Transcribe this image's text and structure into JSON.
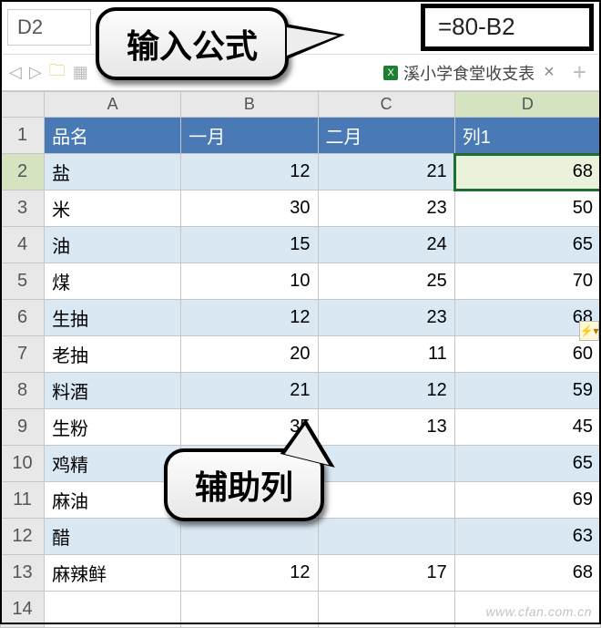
{
  "namebox": "D2",
  "formula": "=80-B2",
  "callouts": {
    "formula_label": "输入公式",
    "helper_col_label": "辅助列"
  },
  "sheet_tab": {
    "title": "溪小学食堂收支表",
    "close": "×",
    "plus": "+"
  },
  "columns": [
    "",
    "A",
    "B",
    "C",
    "D"
  ],
  "header_row": [
    "品名",
    "一月",
    "二月",
    "列1"
  ],
  "active_cell": "D2",
  "selected_column": "D",
  "chart_data": {
    "type": "table",
    "columns": [
      "品名",
      "一月",
      "二月",
      "列1"
    ],
    "rows": [
      {
        "品名": "盐",
        "一月": 12,
        "二月": 21,
        "列1": 68
      },
      {
        "品名": "米",
        "一月": 30,
        "二月": 23,
        "列1": 50
      },
      {
        "品名": "油",
        "一月": 15,
        "二月": 24,
        "列1": 65
      },
      {
        "品名": "煤",
        "一月": 10,
        "二月": 25,
        "列1": 70
      },
      {
        "品名": "生抽",
        "一月": 12,
        "二月": 23,
        "列1": 68
      },
      {
        "品名": "老抽",
        "一月": 20,
        "二月": 11,
        "列1": 60
      },
      {
        "品名": "料酒",
        "一月": 21,
        "二月": 12,
        "列1": 59
      },
      {
        "品名": "生粉",
        "一月": 35,
        "二月": 13,
        "列1": 45
      },
      {
        "品名": "鸡精",
        "一月": null,
        "二月": null,
        "列1": 65
      },
      {
        "品名": "麻油",
        "一月": null,
        "二月": null,
        "列1": 69
      },
      {
        "品名": "醋",
        "一月": null,
        "二月": null,
        "列1": 63
      },
      {
        "品名": "麻辣鲜",
        "一月": 12,
        "二月": 17,
        "列1": 68
      }
    ]
  },
  "extra_row_numbers": [
    14
  ],
  "watermark": "www.cfan.com.cn"
}
